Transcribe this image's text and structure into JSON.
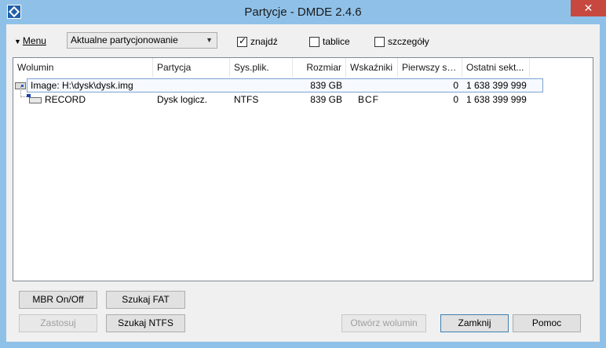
{
  "window": {
    "title": "Partycje - DMDE 2.4.6",
    "close_label": "✕"
  },
  "toolbar": {
    "menu_arrow": "▼",
    "menu_label": "Menu",
    "view_select": "Aktualne partycjonowanie",
    "find_label": "znajdź",
    "find_checked": true,
    "tables_label": "tablice",
    "tables_checked": false,
    "details_label": "szczegóły",
    "details_checked": false
  },
  "list": {
    "columns": [
      "Wolumin",
      "Partycja",
      "Sys.plik.",
      "Rozmiar",
      "Wskaźniki",
      "Pierwszy se...",
      "Ostatni sekt..."
    ],
    "rows": [
      {
        "icon": "disk-image-icon",
        "volume": "Image: H:\\dysk\\dysk.img",
        "partition": "",
        "fs": "",
        "size": "839 GB",
        "flags": "",
        "first": "0",
        "last": "1 638 399 999"
      },
      {
        "icon": "logical-volume-icon",
        "volume": "RECORD",
        "partition": "Dysk logicz.",
        "fs": "NTFS",
        "size": "839 GB",
        "flags": "BCF",
        "first": "0",
        "last": "1 638 399 999"
      }
    ]
  },
  "buttons": {
    "mbr": "MBR On/Off",
    "search_fat": "Szukaj FAT",
    "apply": "Zastosuj",
    "search_ntfs": "Szukaj NTFS",
    "open_volume": "Otwórz wolumin",
    "close": "Zamknij",
    "help": "Pomoc"
  }
}
